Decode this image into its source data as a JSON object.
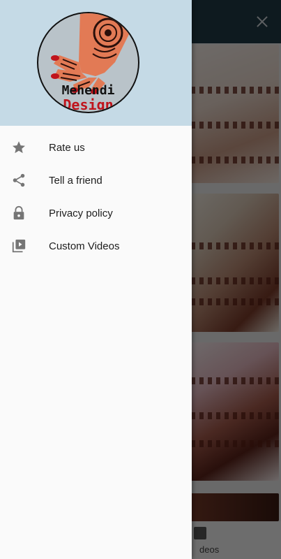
{
  "drawer": {
    "logo": {
      "line1": "Mehendi",
      "line2": "Design"
    },
    "menu_items": [
      {
        "label": "Rate us",
        "icon": "star-icon"
      },
      {
        "label": "Tell a friend",
        "icon": "share-icon"
      },
      {
        "label": "Privacy policy",
        "icon": "lock-icon"
      },
      {
        "label": "Custom Videos",
        "icon": "video-library-icon"
      }
    ]
  },
  "background": {
    "bottom_nav_label": "deos"
  },
  "colors": {
    "header_bg": "#c5dae6",
    "icon_gray": "#757575",
    "logo_red": "#c0141c"
  }
}
